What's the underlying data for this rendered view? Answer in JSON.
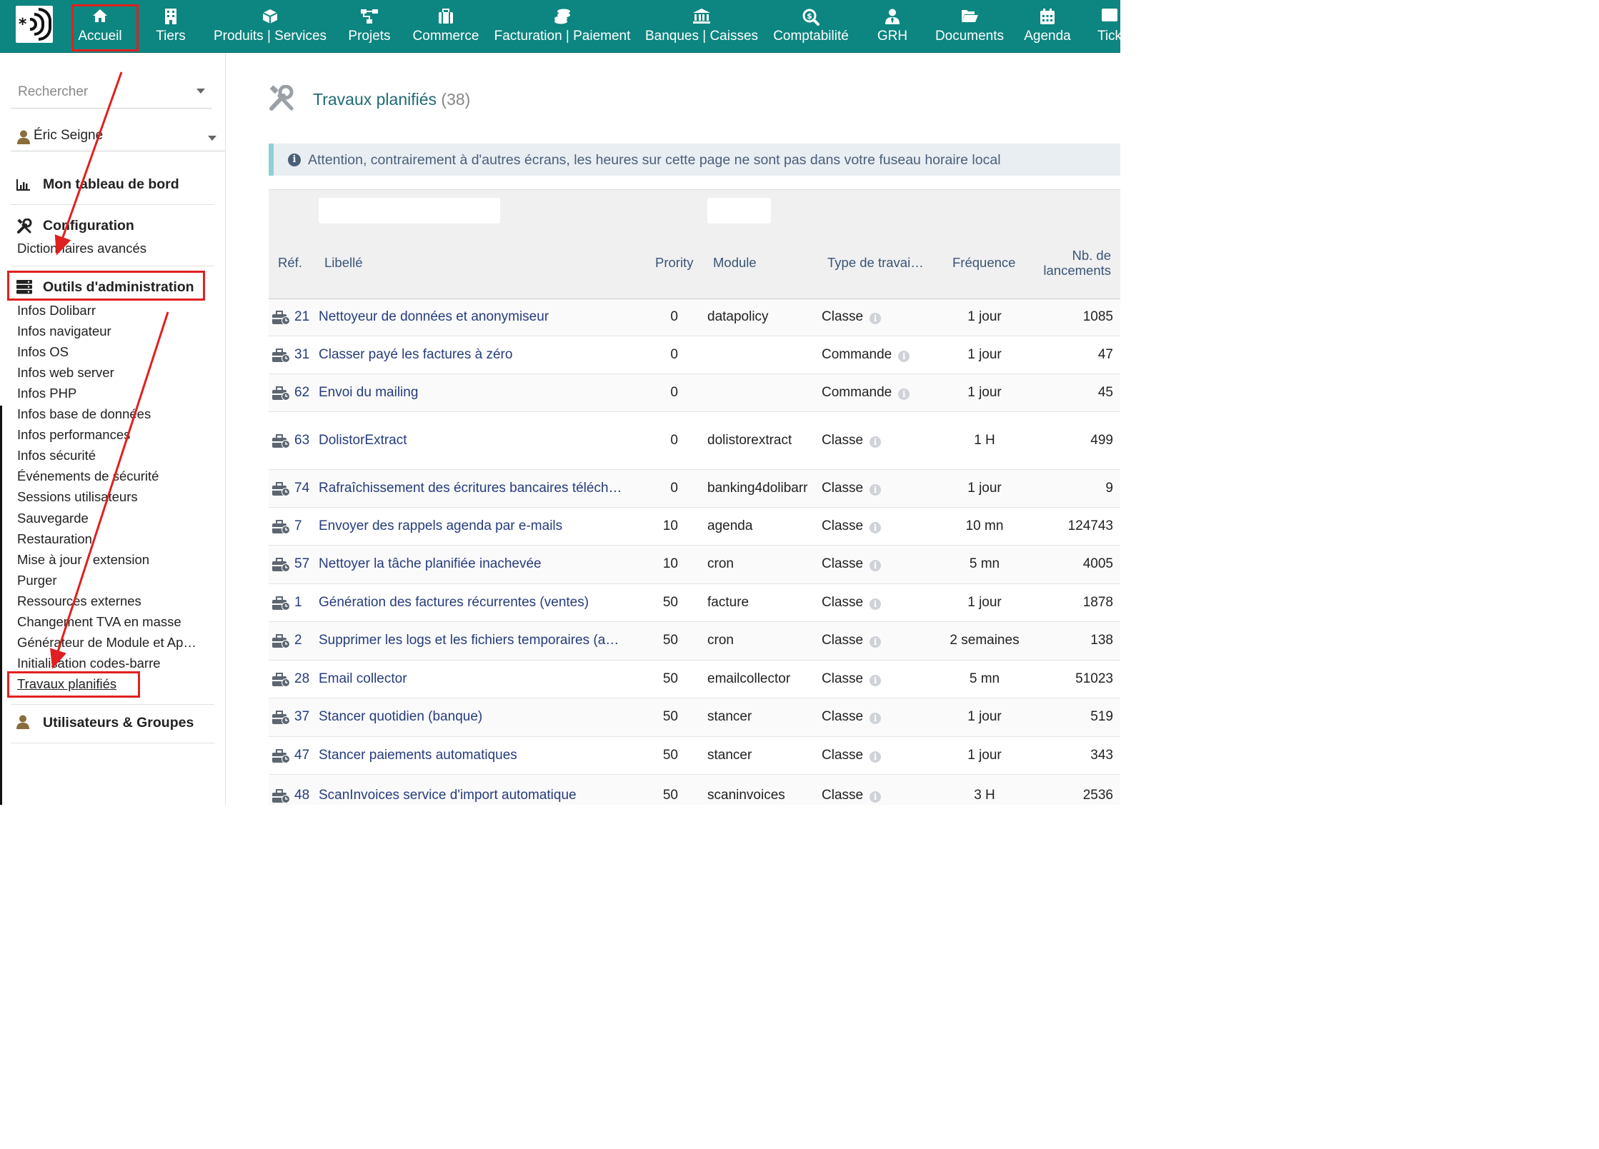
{
  "topmenu": [
    {
      "label": "Accueil",
      "icon": "home-icon"
    },
    {
      "label": "Tiers",
      "icon": "building-icon"
    },
    {
      "label": "Produits | Services",
      "icon": "cube-icon"
    },
    {
      "label": "Projets",
      "icon": "sitemap-icon"
    },
    {
      "label": "Commerce",
      "icon": "suitcase-icon"
    },
    {
      "label": "Facturation | Paiement",
      "icon": "coins-icon"
    },
    {
      "label": "Banques | Caisses",
      "icon": "bank-icon"
    },
    {
      "label": "Comptabilité",
      "icon": "search-dollar-icon"
    },
    {
      "label": "GRH",
      "icon": "user-tie-icon"
    },
    {
      "label": "Documents",
      "icon": "folder-open-icon"
    },
    {
      "label": "Agenda",
      "icon": "calendar-icon"
    },
    {
      "label": "Tick",
      "icon": "ticket-icon"
    }
  ],
  "leftpanel": {
    "search_placeholder": "Rechercher",
    "user_name": "Éric Seigne",
    "dashboard_label": "Mon tableau de bord",
    "config_title": "Configuration",
    "config_links": [
      "Dictionnaires avancés"
    ],
    "admin_title": "Outils d'administration",
    "admin_links": [
      "Infos Dolibarr",
      "Infos navigateur",
      "Infos OS",
      "Infos web server",
      "Infos PHP",
      "Infos base de données",
      "Infos performances",
      "Infos sécurité",
      "Événements de sécurité",
      "Sessions utilisateurs",
      "Sauvegarde",
      "Restauration",
      "Mise à jour / extension",
      "Purger",
      "Ressources externes",
      "Changement TVA en masse",
      "Générateur de Module et Ap…",
      "Initialisation codes-barre",
      "Travaux planifiés"
    ],
    "users_title": "Utilisateurs & Groupes"
  },
  "page": {
    "title": "Travaux planifiés",
    "count": "(38)",
    "info": "Attention, contrairement à d'autres écrans, les heures sur cette page ne sont pas dans votre fuseau horaire local"
  },
  "table": {
    "headers": {
      "ref": "Réf.",
      "label": "Libellé",
      "priority": "Prority",
      "module": "Module",
      "type": "Type de travai…",
      "frequency": "Fréquence",
      "launches_1": "Nb. de",
      "launches_2": "lancements"
    },
    "rows": [
      {
        "ref": "21",
        "label": "Nettoyeur de données et anonymiseur",
        "priority": "0",
        "module": "datapolicy",
        "type": "Classe",
        "frequency": "1 jour",
        "launches": "1085"
      },
      {
        "ref": "31",
        "label": "Classer payé les factures à zéro",
        "priority": "0",
        "module": "",
        "type": "Commande",
        "frequency": "1 jour",
        "launches": "47"
      },
      {
        "ref": "62",
        "label": "Envoi du mailing",
        "priority": "0",
        "module": "",
        "type": "Commande",
        "frequency": "1 jour",
        "launches": "45"
      },
      {
        "ref": "63",
        "label": "DolistorExtract",
        "priority": "0",
        "module": "dolistorextract",
        "type": "Classe",
        "frequency": "1 H",
        "launches": "499"
      },
      {
        "ref": "74",
        "label": "Rafraîchissement des écritures bancaires téléch…",
        "priority": "0",
        "module": "banking4dolibarr",
        "type": "Classe",
        "frequency": "1 jour",
        "launches": "9"
      },
      {
        "ref": "7",
        "label": "Envoyer des rappels agenda par e-mails",
        "priority": "10",
        "module": "agenda",
        "type": "Classe",
        "frequency": "10 mn",
        "launches": "124743"
      },
      {
        "ref": "57",
        "label": "Nettoyer la tâche planifiée inachevée",
        "priority": "10",
        "module": "cron",
        "type": "Classe",
        "frequency": "5 mn",
        "launches": "4005"
      },
      {
        "ref": "1",
        "label": "Génération des factures récurrentes (ventes)",
        "priority": "50",
        "module": "facture",
        "type": "Classe",
        "frequency": "1 jour",
        "launches": "1878"
      },
      {
        "ref": "2",
        "label": "Supprimer les logs et les fichiers temporaires (a…",
        "priority": "50",
        "module": "cron",
        "type": "Classe",
        "frequency": "2 semaines",
        "launches": "138"
      },
      {
        "ref": "28",
        "label": "Email collector",
        "priority": "50",
        "module": "emailcollector",
        "type": "Classe",
        "frequency": "5 mn",
        "launches": "51023"
      },
      {
        "ref": "37",
        "label": "Stancer quotidien (banque)",
        "priority": "50",
        "module": "stancer",
        "type": "Classe",
        "frequency": "1 jour",
        "launches": "519"
      },
      {
        "ref": "47",
        "label": "Stancer paiements automatiques",
        "priority": "50",
        "module": "stancer",
        "type": "Classe",
        "frequency": "1 jour",
        "launches": "343"
      },
      {
        "ref": "48",
        "label": "ScanInvoices service d'import automatique",
        "priority": "50",
        "module": "scaninvoices",
        "type": "Classe",
        "frequency": "3 H",
        "launches": "2536"
      }
    ]
  },
  "colors": {
    "topbar": "#0d8580",
    "annotation": "#e02020",
    "link": "#263c7d",
    "title": "#1f6b73"
  }
}
